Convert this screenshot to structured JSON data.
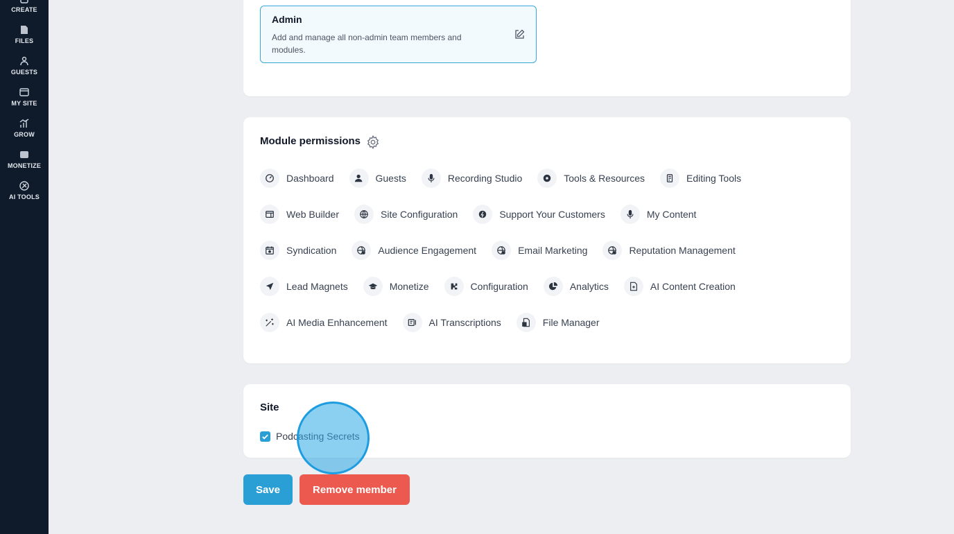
{
  "sidebar": {
    "items": [
      {
        "label": "CREATE",
        "icon": "create-icon"
      },
      {
        "label": "FILES",
        "icon": "files-icon"
      },
      {
        "label": "GUESTS",
        "icon": "guests-icon"
      },
      {
        "label": "MY SITE",
        "icon": "my-site-icon"
      },
      {
        "label": "GROW",
        "icon": "grow-icon"
      },
      {
        "label": "MONETIZE",
        "icon": "monetize-icon"
      },
      {
        "label": "AI TOOLS",
        "icon": "ai-tools-icon"
      }
    ]
  },
  "role": {
    "title": "Admin",
    "description": "Add and manage all non-admin team members and modules.",
    "edit_icon": "edit-icon"
  },
  "module_permissions": {
    "title": "Module permissions",
    "settings_icon": "gear-icon",
    "rows": [
      [
        {
          "label": "Dashboard",
          "icon": "dashboard-icon"
        },
        {
          "label": "Guests",
          "icon": "guests-icon"
        },
        {
          "label": "Recording Studio",
          "icon": "microphone-icon"
        },
        {
          "label": "Tools & Resources",
          "icon": "tools-icon"
        },
        {
          "label": "Editing Tools",
          "icon": "editing-icon"
        }
      ],
      [
        {
          "label": "Web Builder",
          "icon": "web-builder-icon"
        },
        {
          "label": "Site Configuration",
          "icon": "globe-icon"
        },
        {
          "label": "Support Your Customers",
          "icon": "support-icon"
        },
        {
          "label": "My Content",
          "icon": "microphone-icon"
        }
      ],
      [
        {
          "label": "Syndication",
          "icon": "calendar-icon"
        },
        {
          "label": "Audience Engagement",
          "icon": "engagement-icon"
        },
        {
          "label": "Email Marketing",
          "icon": "email-icon"
        },
        {
          "label": "Reputation Management",
          "icon": "reputation-icon"
        }
      ],
      [
        {
          "label": "Lead Magnets",
          "icon": "paper-plane-icon"
        },
        {
          "label": "Monetize",
          "icon": "graduation-cap-icon"
        },
        {
          "label": "Configuration",
          "icon": "puzzle-icon"
        },
        {
          "label": "Analytics",
          "icon": "pie-chart-icon"
        },
        {
          "label": "AI Content Creation",
          "icon": "document-icon"
        }
      ],
      [
        {
          "label": "AI Media Enhancement",
          "icon": "wand-icon"
        },
        {
          "label": "AI Transcriptions",
          "icon": "transcription-icon"
        },
        {
          "label": "File Manager",
          "icon": "file-manager-icon"
        }
      ]
    ]
  },
  "site": {
    "title": "Site",
    "checkbox_label": "Podcasting Secrets",
    "checked": true
  },
  "actions": {
    "save_label": "Save",
    "remove_label": "Remove member"
  },
  "colors": {
    "accent": "#2a9fd6",
    "danger": "#ec5a4f",
    "sidebar": "#0f1b2a"
  }
}
